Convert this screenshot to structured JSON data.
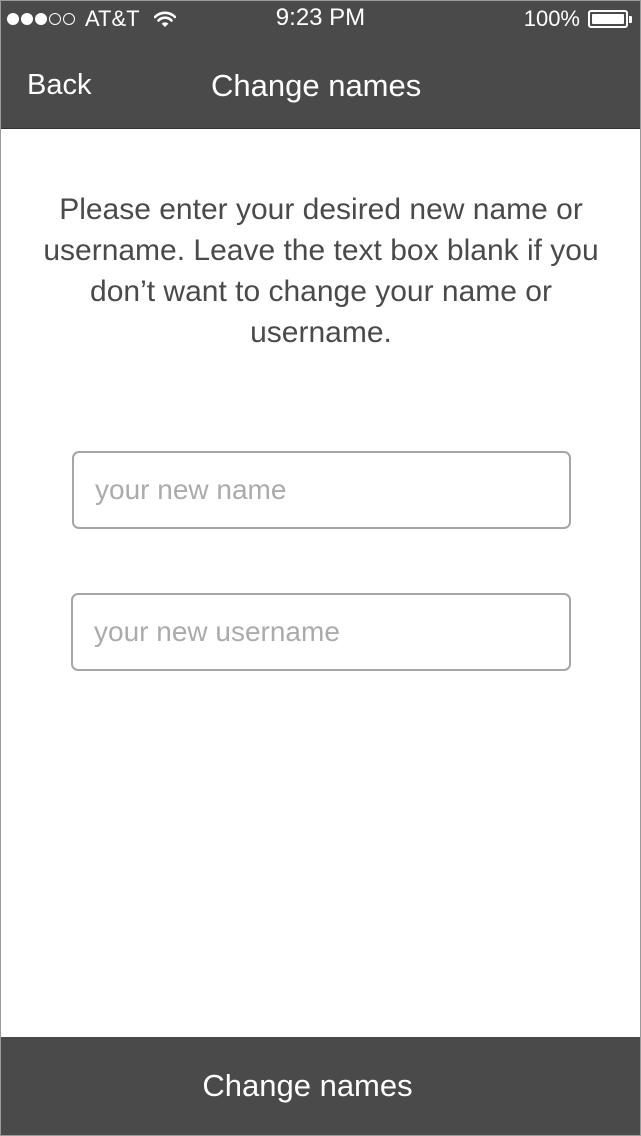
{
  "status_bar": {
    "carrier": "AT&T",
    "signal": {
      "filled": 3,
      "total": 5
    },
    "time": "9:23 PM",
    "battery_percent": "100%",
    "battery_level": 1.0,
    "icons": [
      "signal-dots-icon",
      "wifi-icon",
      "battery-icon"
    ]
  },
  "nav": {
    "back_label": "Back",
    "title": "Change names"
  },
  "main": {
    "instructions": "Please enter your desired new name or username. Leave the text box blank if you don’t want to change your name or username.",
    "name_input": {
      "value": "",
      "placeholder": "your new name"
    },
    "username_input": {
      "value": "",
      "placeholder": "your new username"
    }
  },
  "footer": {
    "submit_label": "Change names"
  },
  "colors": {
    "bar_background": "#4a4a4a",
    "bar_text": "#ffffff",
    "body_text": "#4a4a4a",
    "input_border": "#a6a6a6",
    "placeholder": "#ababab"
  }
}
